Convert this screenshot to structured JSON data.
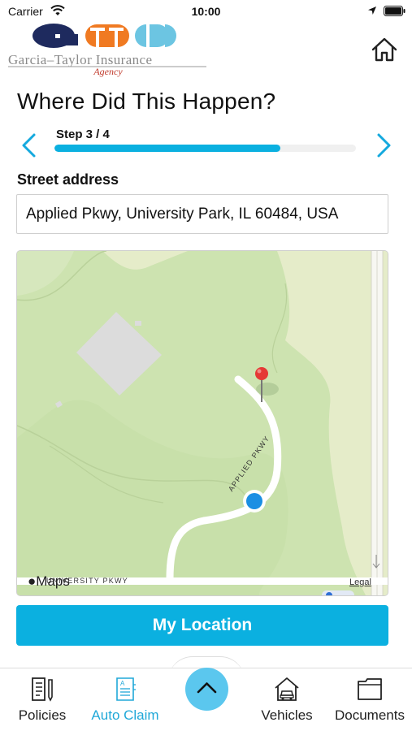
{
  "status_bar": {
    "carrier": "Carrier",
    "time": "10:00"
  },
  "header": {
    "logo_text": "Garcia–Taylor Insurance",
    "logo_subtext": "Agency",
    "home_icon": "home-icon"
  },
  "page": {
    "title": "Where Did This Happen?"
  },
  "stepper": {
    "label": "Step 3 / 4",
    "progress": 0.75,
    "prev_icon": "chevron-left-icon",
    "next_icon": "chevron-right-icon"
  },
  "address": {
    "label": "Street address",
    "value": "Applied Pkwy, University Park, IL 60484, USA"
  },
  "map": {
    "brand": "Maps",
    "legal": "Legal",
    "road_labels": [
      "APPLIED PKWY",
      "UNIVERSITY PKWY"
    ]
  },
  "actions": {
    "my_location": "My Location"
  },
  "tab_bar": {
    "items": [
      {
        "label": "Policies",
        "icon": "policies-icon"
      },
      {
        "label": "Auto Claim",
        "icon": "auto-claim-icon"
      },
      {
        "label": "Vehicles",
        "icon": "vehicles-icon"
      },
      {
        "label": "Documents",
        "icon": "documents-icon"
      }
    ],
    "active": "Auto Claim",
    "center_icon": "chevron-up-icon"
  },
  "colors": {
    "accent": "#0bb0e0",
    "accent_light": "#5bc7ee",
    "active_tab": "#20a8d8",
    "logo_navy": "#1e2a5e",
    "logo_orange": "#f07a22",
    "logo_cyan": "#6cc5e2",
    "pin_red": "#e53935"
  }
}
